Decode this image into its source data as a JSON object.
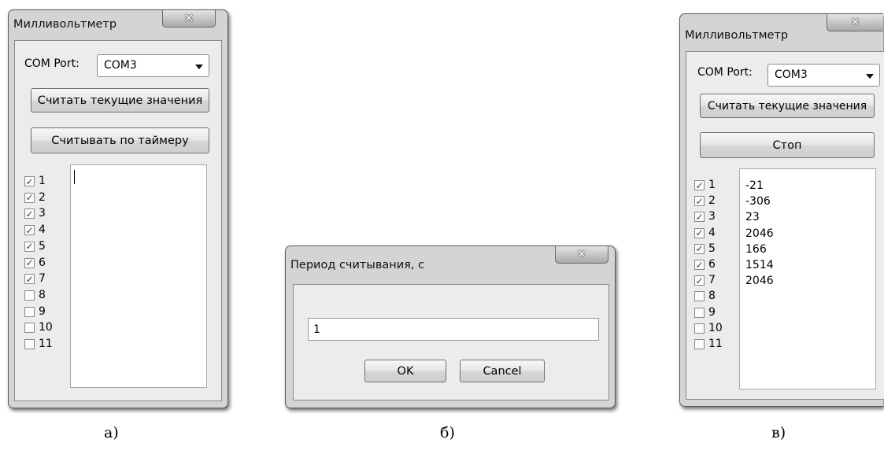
{
  "window_a": {
    "title": "Милливольтметр",
    "com_label": "COM Port:",
    "com_value": "COM3",
    "read_button": "Считать текущие значения",
    "timer_button": "Считывать по таймеру",
    "channels": [
      {
        "num": "1",
        "checked": true
      },
      {
        "num": "2",
        "checked": true
      },
      {
        "num": "3",
        "checked": true
      },
      {
        "num": "4",
        "checked": true
      },
      {
        "num": "5",
        "checked": true
      },
      {
        "num": "6",
        "checked": true
      },
      {
        "num": "7",
        "checked": true
      },
      {
        "num": "8",
        "checked": false
      },
      {
        "num": "9",
        "checked": false
      },
      {
        "num": "10",
        "checked": false
      },
      {
        "num": "11",
        "checked": false
      }
    ]
  },
  "dialog_b": {
    "title": "Период считывания, с",
    "input_value": "1",
    "ok_label": "OK",
    "cancel_label": "Cancel"
  },
  "window_c": {
    "title": "Милливольтметр",
    "com_label": "COM Port:",
    "com_value": "COM3",
    "read_button": "Считать текущие значения",
    "stop_button": "Стоп",
    "channels": [
      {
        "num": "1",
        "checked": true
      },
      {
        "num": "2",
        "checked": true
      },
      {
        "num": "3",
        "checked": true
      },
      {
        "num": "4",
        "checked": true
      },
      {
        "num": "5",
        "checked": true
      },
      {
        "num": "6",
        "checked": true
      },
      {
        "num": "7",
        "checked": true
      },
      {
        "num": "8",
        "checked": false
      },
      {
        "num": "9",
        "checked": false
      },
      {
        "num": "10",
        "checked": false
      },
      {
        "num": "11",
        "checked": false
      }
    ],
    "values": [
      "-21",
      "-306",
      "23",
      "2046",
      "166",
      "1514",
      "2046"
    ]
  },
  "captions": {
    "a": "а)",
    "b": "б)",
    "c": "в)"
  },
  "icons": {
    "close": "close-icon",
    "dropdown": "chevron-down-icon",
    "checkmark": "checkmark-icon"
  }
}
